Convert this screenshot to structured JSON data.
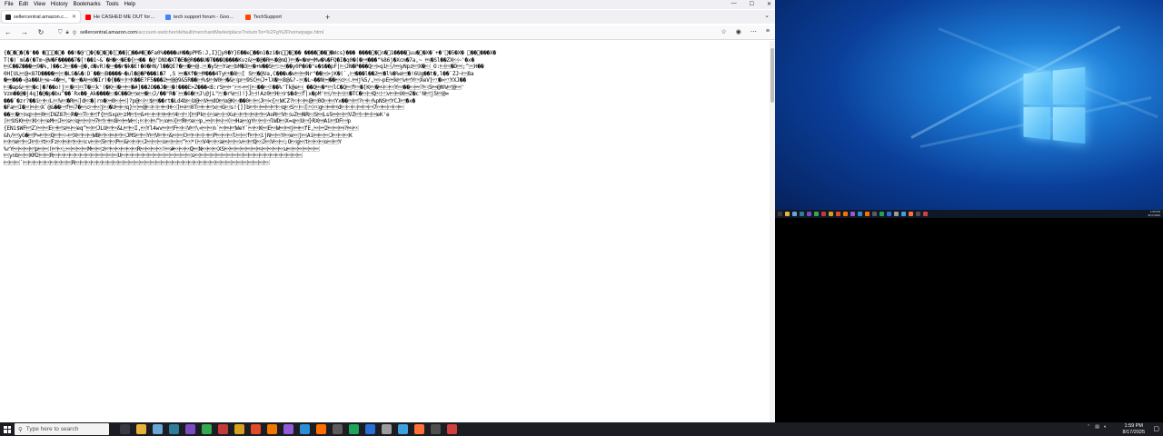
{
  "browser": {
    "menu": [
      "File",
      "Edit",
      "View",
      "History",
      "Bookmarks",
      "Tools",
      "Help"
    ],
    "window_controls": {
      "minimize": "—",
      "maximize": "☐",
      "close": "✕"
    },
    "tabs": [
      {
        "title": "sellercentral.amazon.com/accou",
        "favicon_color": "#222222",
        "active": true
      },
      {
        "title": "He CASHED ME OUT for My M",
        "favicon_color": "#ff0000",
        "active": false
      },
      {
        "title": "tech support forum - Google Se",
        "favicon_color": "#4285f4",
        "active": false
      },
      {
        "title": "TechSupport",
        "favicon_color": "#ff4500",
        "active": false
      }
    ],
    "new_tab": "+",
    "list_all_tabs": "⌄",
    "nav": {
      "back": "←",
      "forward": "→",
      "reload": "↻",
      "home": "⌂"
    },
    "url": {
      "host": "sellercentral.amazon.com",
      "rest": "/account-switcher/default/merchantMarketplace?returnTo=%2Fg%2Fhomepage.html",
      "prefix": "sellercentral.amazon.com"
    },
    "url_icons": [
      "shield-icon",
      "lock-icon",
      "permissions-icon"
    ],
    "right_buttons": [
      "☆",
      "◉",
      "⋯",
      "≡"
    ]
  },
  "page_lines": [
    "{�\u0000�\u0019�{�'�� �\u0015\u0015\u0019�\u0017� ��!�@'\u0000�{�\u0013�\u0011�[\u0002��}\u001b��#�\u0007�Fa0%����uH��pPM5:J,I}\u001fy0�Y}E��e\u0017��n1�zi�n\u0002\u0011�\u0016�� ����\u0017��\u0015�Wcs}��� ����\u0014�\u0007n�\u00131����\u0010uu�\u0017�X�`+�'\u0017�5�X� \u001b��\u0018���X�",
    "T(�)`m&�(�Tm~@W�F�����7�[!��1~&`�H�\u0014�E�{\u0016�� �@'DNb�XT�E�@R���U�T���Q����Kvz&\u0018�@�R\u0007�@mQ)\u0003�<�m\u0005Mw�%�FQ�I�q0�(�\u001a���\"%86j�Xcm�7a,~ \u0007�Sl��ZX\u0011~'�x�",
    "\u0007C��Z���\u00189�%,)��cJ\u0013��~@�,d�vR)�\u0016��r�k�E!�0�HN/l��QE?�\u0006�\u0005@.\u001d�y5\u0000Ya\u0006bM�3\u0010�+W��S\u0004:\u0010��y0P�6�\"e�$��pF|\u0011JN�P���Q\u0016>q1\u0013/\u0015yNpz\u0004X�\u0012_O:\u0014\u000e�D\u0018;^\u001fH��",
    "0H[UL\u0006@<87D����\u0015\u001d�LS�&�:D`��\u0011B����~�ul�@�P���i�7 ,S \u0015�Xf�\u0001M���4Ty\u0017�8\u0012[ S\u0003�@Va,C���u�v\u0006\u0015Nr\"��\u0010>jK�(`,\u0016���l��2\u0015�l%�%e\u0004�!6Ug��t�,l��`ZJ~\u00038a",
    "�\u0015���~@a��U\u0016e~4�\u0005,\"�\u0016�A\u0005d�Ir)�{��\u001d\u0003K��E?F5���2\u0015@@9&5R��\u0016%$\u0003W0\u0014�&\u0012p\u00029SC\u0007J+lX�\u00108@&?-\u001d�L~��N\u0018��\u0006c\u0011.\u0005j%5/,\u0010~pE\u0018k\u0004v\u0004Y\u0002XeV}\u000b�>\u000bYXJ��",
    "\u0012�ap&\u0016\u0002�c|�?��o!j\u001d�\u000f\u000fT�\u000fk'(�K\u0012�\u0001\u0006�#]��2O��J�\u0012�!���E>Z���<B:rS\u0005+'\u0016~\u0015j\u0012��\u0014!��%'Tk@e\u0011_��Q\u0007�*\u0002lC�Q\u0006f\u0003�[K\u0003�\u0007\u0013\u0006Y\u0010��\u0011\u0015?\u00125\u0005@N%\u0004@\u0001'",
    "Vzm��@�j4q]�@�p�bu^��`Rx��_Ak����\u0012�C��O\u0004e\u0018�\u0011J/��\"R�`\u0006�6�\u0017J\\@jL\"\u001c�r%\u0003)!}J\u0016!Az0\u0004H\u0016r$�d\u0006f|x�pM'\u0017/\u0019\u0006\u000f�TC�\u0006\u0016Q\u001e\u000bv\u0006\u0005X\u0005Z�c'N\u0004j5\u0017@=",
    "���`�zr?��i\u0016\u0011L\u000e%\u001b�R\u0007]d\u001b�|rn�\u00180\u0011\u0015|?p@\u0012\u001e$\u0017��rt�Ld4b\u0012U@\u0006V\u0015dO\u0004o@K\u0011��0\u0013\u0006J\u0003<{\u001eWCZ?\u0013\u0011\u0007@\u00030O\u0016\u0010Yx��\u0002\u0004?\u0016\u0014%pNS\u0004YCJ\u0004�x�",
    "�Fa\u001bI�\u001d\u0007\u0014X`@&��\u0016f\u00077�\u0006c\u0016\u0006j\u0012�U\u0005\u0014q}\u001e\u0015@\u0012\u0013\u0016\u0006H\u0012]\u0007\u00030T\u0001\u0016\u0004x\u0016G\u0013s!{]]b\u0004\u0013\u0015\u0006\u0004\u0014q\u0014S\u001c\u0012[\u001c\u000fg\u0013\u0015\u0017d\u0013\u0014\u0012\u001a\u0016\u00167\u0016\u0006\u0016\u0016\u0019",
    "��\u001d�\u0003nq\u0010\u00150\u0006INZ87\u0012R�\u0006T\u0016\u0004f{\u0017Sxp\u0019zM\u0004\u0018&+\u0014\u0006\u0017\u0015\u00044\u0016\u001c{\u0017Pk\u0011\u000ee\u0006\u0016Xu\u0011\u0004\u0006\u0007\u0004\u0006AoR\u0004V\u0012uZ\u0005NR\u0012S\u0005Ls5\u0015\u0006\u0004VZ\u0004\u0016\u0019\u0001eK'e",
    "|\u0004USK\u0005\u001eK\u0012\u0006eM\u0006J\u0006s\u0006q\u0006\u0006\u00017\u0004\u0016\u00078\u0006\u0015W\u0006;\u0012\u0011\u0007^\u0011o\u0007{\u0004R\u0004e\u0016p,\u0015\u000e\u0007\u0016(\u0001Ha\u0006gY\u0013\u0006\u0016lWD\u0006X=q\u0006U\u0016}RX\u0005Ai\u0004OF\u0016p",
    "{ENi$WF\u0004Z)\u0006\u0006E\u0016\u0004s\u0007\u0006eq^\u0006\u0004JLU\u0004\u0006&L\u0004\u0006I,\u0006Yl4wv\u0006\u0004F\u0006\u0012V\u0004\\<\u0006\u0006n`\u0006\u0007\u0004WeY`\u0006\u0006K\u0006E\u0006W\u0006\u0005j\u0005\u0006fE,\u0006\u00182\u0006\u0006\u0005?\u0007\u0006",
    "&h/\u0004yG�\u0004P=\u0004\u0006Q\u0004\u0006~\u0004X\u0004\u0006\u0006WB\u0004\u0006\u0007\u0004\u0006JMS\u0004\u0006Y\u0004V\u0004\u0006&\u0006\u0006C\u0004\u0006\u0006\u0016\u0006P\u0006\u0006\u0006l\u0006\u0006f\u0004\u0006ijN\u0006\u0006Y\u0006e\u0006j\u0006Ai\u0005\u0006\u0006J\u0006\u0006\u0006K",
    "\u0006\u0004e\u0004\u0006J\u0004\u0016t\u0006Fz\u0006\u0007\u0004\u0006\u0006cv\u0006\u00065\u0004\u0006P\u0006&\u0006\u0006\u0006J\u0006\u0006\u0006o\u0006\u0006\u0006^\u0006*(\u0006V4\u0006\u0006a\u0007\u0006\u0006v\u0006\u0004Q\u0006J\u0006V\u0006\u0006;O\u0006g\u0006t\u0006\u0006\u0006o\u0006\u0004Y",
    "%rY\u0006\u0006\u0006\u0004p\u0006\u0006(\u0004\u0006;\u0006\u0006\u0006\u0006M\u0006\u0006z\u0004\u0006\u0006\u0006\u0006\u0006R\u0006\u0006\u0006\u0006!\u0006#\u0006\u0006\u0006Q\u0006N\u0006\u0006\u0006XS\u0006\u0006\u0006\u0006\u0006\u0006\u0007\u0006\u0006\u0006\u0006u\u0006\u0006\u0006\u0006\u0006\u0006",
    "\u0006ynb\u0006\u0006KM2\u0006\u0006R\u0006\u0006\u0006\u0006\u0006\u0006\u0006\u0006\u0006\u0006\u0006\u0006U\u0006\u0006\u0006\u0006\u0006\u0006\u0006\u0006\u0006\u0006\u0006\u0006\u0006s\u0006\u0006\u0006\u0006\u0006\u0006\u0006\u0006\u0006\u0006\u0006\u0006\u0006\u0006\u0006\u0006\u0006\u0006\u0006\u0006",
    "\u0006\u0006\u0006`\u0006\u0006\u0006\u0006\u0006\u0006\u0006\u0006\u0006R\u0006\u0006\u0006\u0006\u0006\u0006\u0006\u0006\u0006\u0006\u0006\u0006\u0006\u0006\u0006\u0006\u0006\u0006\u0006\u0006\u0006\u0006\u0006\u0006\u0006\u0006\u0006\u0006\u0006\u0006\u0006\u0006\u0006\u0006\u0006\u0006"
  ],
  "desktop": {
    "right_clock": {
      "time": "1:59 PM",
      "date": "8/17/2025"
    }
  },
  "taskbar": {
    "search_placeholder": "Type here to search",
    "pinned": [
      {
        "name": "task-view-icon",
        "color": "#3a3b42"
      },
      {
        "name": "file-explorer-icon",
        "color": "#e8b33a"
      },
      {
        "name": "notepad-icon",
        "color": "#6aa6d6"
      },
      {
        "name": "app-icon-1",
        "color": "#2d7d9a"
      },
      {
        "name": "app-icon-2",
        "color": "#7a4cc2"
      },
      {
        "name": "chrome-icon",
        "color": "#34a853"
      },
      {
        "name": "app-icon-3",
        "color": "#c23b3b"
      },
      {
        "name": "app-icon-4",
        "color": "#d8a020"
      },
      {
        "name": "app-icon-5",
        "color": "#e04a2a"
      },
      {
        "name": "app-icon-6",
        "color": "#f07800"
      },
      {
        "name": "app-icon-7",
        "color": "#8f5bd6"
      },
      {
        "name": "app-icon-8",
        "color": "#2c8fd6"
      },
      {
        "name": "app-icon-9",
        "color": "#ff6f00"
      },
      {
        "name": "app-icon-10",
        "color": "#5b5b5b"
      },
      {
        "name": "app-icon-11",
        "color": "#1ea55a"
      },
      {
        "name": "app-icon-12",
        "color": "#2a6fd6"
      },
      {
        "name": "app-icon-13",
        "color": "#9c9c9c"
      },
      {
        "name": "app-icon-14",
        "color": "#3fa0e0"
      },
      {
        "name": "firefox-icon",
        "color": "#ff7139"
      },
      {
        "name": "app-icon-15",
        "color": "#4f4f4f"
      },
      {
        "name": "app-icon-16",
        "color": "#d04040"
      }
    ],
    "clock": {
      "time": "1:59 PM",
      "date": "8/17/2025"
    },
    "notification": "▢"
  }
}
